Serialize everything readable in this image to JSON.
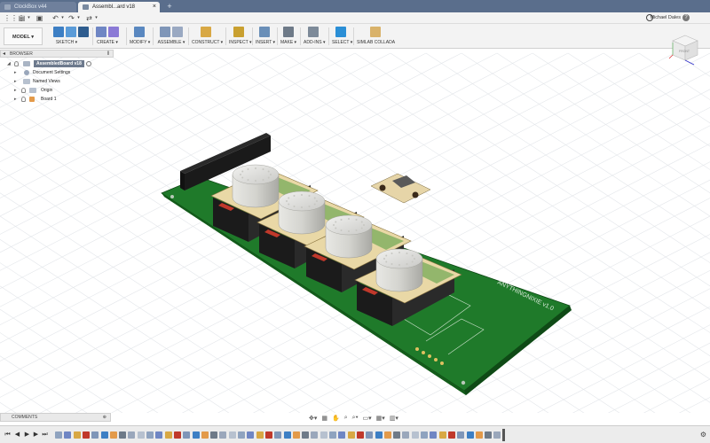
{
  "tabs": [
    {
      "label": "ClockBox v44",
      "active": false
    },
    {
      "label": "Assembl...ard v18",
      "active": true
    }
  ],
  "user": {
    "name": "Michael Dales"
  },
  "toolbar": {
    "workspace": "MODEL ▾",
    "groups": [
      {
        "label": "SKETCH ▾",
        "colors": [
          "#3d7fc4",
          "#5a9bd8",
          "#2f5d8f"
        ]
      },
      {
        "label": "CREATE ▾",
        "colors": [
          "#6f86c4",
          "#8b7ad6"
        ]
      },
      {
        "label": "MODIFY ▾",
        "colors": [
          "#5a88c0"
        ]
      },
      {
        "label": "ASSEMBLE ▾",
        "colors": [
          "#7f96b8",
          "#9aa9c2"
        ]
      },
      {
        "label": "CONSTRUCT ▾",
        "colors": [
          "#d8a844"
        ]
      },
      {
        "label": "INSPECT ▾",
        "colors": [
          "#c9a030"
        ]
      },
      {
        "label": "INSERT ▾",
        "colors": [
          "#6a8fb8"
        ]
      },
      {
        "label": "MAKE ▾",
        "colors": [
          "#6e7a88"
        ]
      },
      {
        "label": "ADD-INS ▾",
        "colors": [
          "#7d8a99"
        ]
      },
      {
        "label": "SELECT ▾",
        "colors": [
          "#2b8fd6"
        ]
      },
      {
        "label": "SIMLAB COLLADA",
        "colors": [
          "#d9b26a"
        ]
      }
    ]
  },
  "browser": {
    "header": "BROWSER",
    "root": "AssembledBoard v18",
    "items": [
      {
        "label": "Document Settings",
        "icon_color": "#9aa7bb"
      },
      {
        "label": "Named Views",
        "icon_color": "#b7c1cf"
      },
      {
        "label": "Origin",
        "icon_color": "#b7c1cf"
      },
      {
        "label": "Board 1",
        "icon_color": "#e39a4a"
      }
    ]
  },
  "comments": {
    "label": "COMMENTS"
  },
  "viewport": {
    "board_silkscreen": "ANYTHINGNIXIE v1.0",
    "board_color": "#1f7a2a",
    "viewcube_label": "FRONT"
  },
  "icons": {
    "grid": "app-grid-icon",
    "file": "file-icon",
    "save": "save-icon",
    "undo": "undo-icon",
    "redo": "redo-icon",
    "help": "help-icon",
    "clock": "clock-icon"
  }
}
